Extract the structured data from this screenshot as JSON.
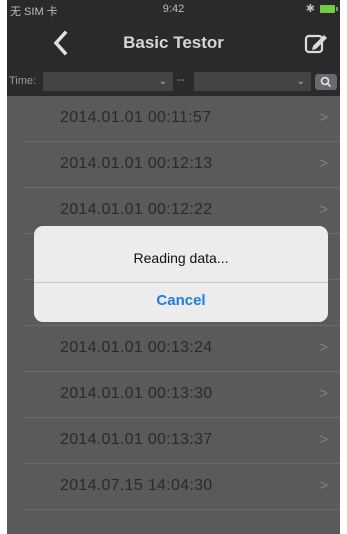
{
  "status": {
    "carrier": "无 SIM 卡",
    "time": "9:42",
    "bluetooth_icon": "bluetooth-icon",
    "battery_color": "#6fcf3f"
  },
  "nav": {
    "title": "Basic Testor",
    "back_icon": "chevron-left-icon",
    "edit_icon": "edit-square-icon"
  },
  "filter": {
    "label": "Time:",
    "dash": "--",
    "search_icon": "search-icon"
  },
  "records": [
    "2014.01.01 00:11:57",
    "2014.01.01 00:12:13",
    "2014.01.01 00:12:22",
    "",
    "",
    "2014.01.01 00:13:24",
    "2014.01.01 00:13:30",
    "2014.01.01 00:13:37",
    "2014.07.15 14:04:30"
  ],
  "dialog": {
    "message": "Reading data...",
    "cancel_label": "Cancel",
    "cancel_color": "#1a7df0"
  }
}
